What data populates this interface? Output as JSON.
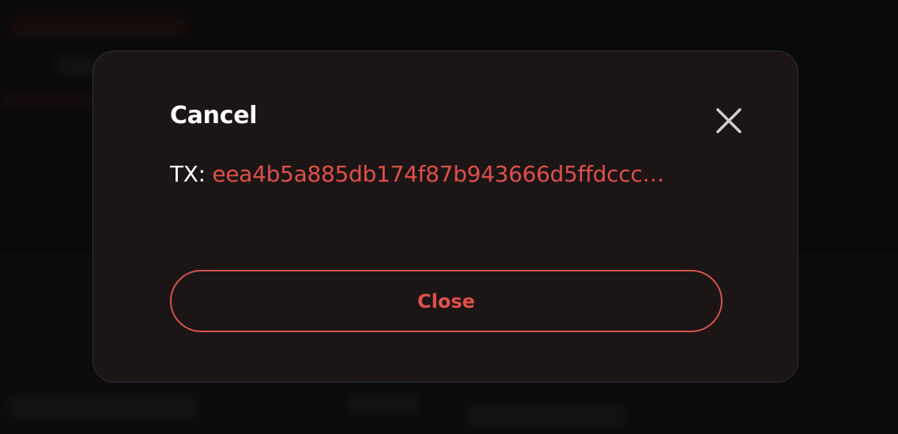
{
  "modal": {
    "title": "Cancel",
    "tx_label": "TX:",
    "tx_hash": "eea4b5a885db174f87b943666d5ffdccc…",
    "close_button_label": "Close",
    "close_icon": "close-icon"
  },
  "colors": {
    "accent": "#e0504a",
    "modal_background": "#1b1516",
    "modal_border": "#2c2f3d",
    "backdrop": "#110e0f",
    "text_primary": "#ffffff"
  }
}
